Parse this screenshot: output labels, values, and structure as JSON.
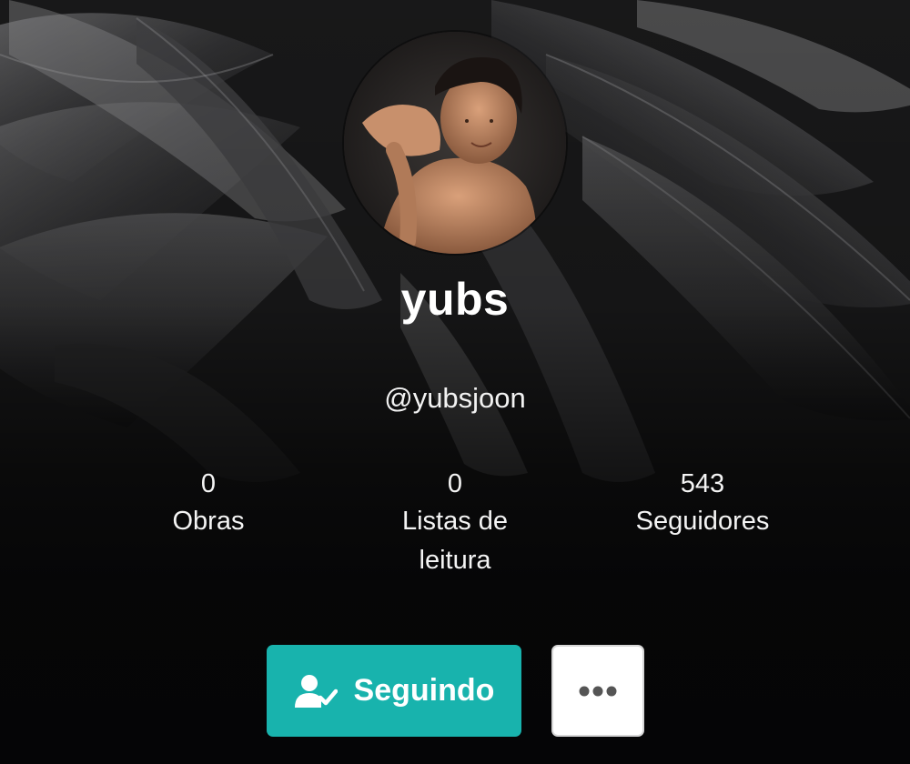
{
  "profile": {
    "display_name": "yubs",
    "username": "@yubsjoon",
    "cover_icon": "black-feathers-image",
    "avatar_icon": "profile-photo-image"
  },
  "stats": {
    "works": {
      "count": "0",
      "label": "Obras"
    },
    "reading_lists": {
      "count": "0",
      "label": "Listas de leitura"
    },
    "followers": {
      "count": "543",
      "label": "Seguidores"
    }
  },
  "actions": {
    "follow_label": "Seguindo",
    "follow_icon": "user-check-icon",
    "more_icon": "more-dots-icon"
  },
  "colors": {
    "accent": "#18b3ad",
    "background": "#0a0a0b",
    "text": "#ffffff"
  }
}
